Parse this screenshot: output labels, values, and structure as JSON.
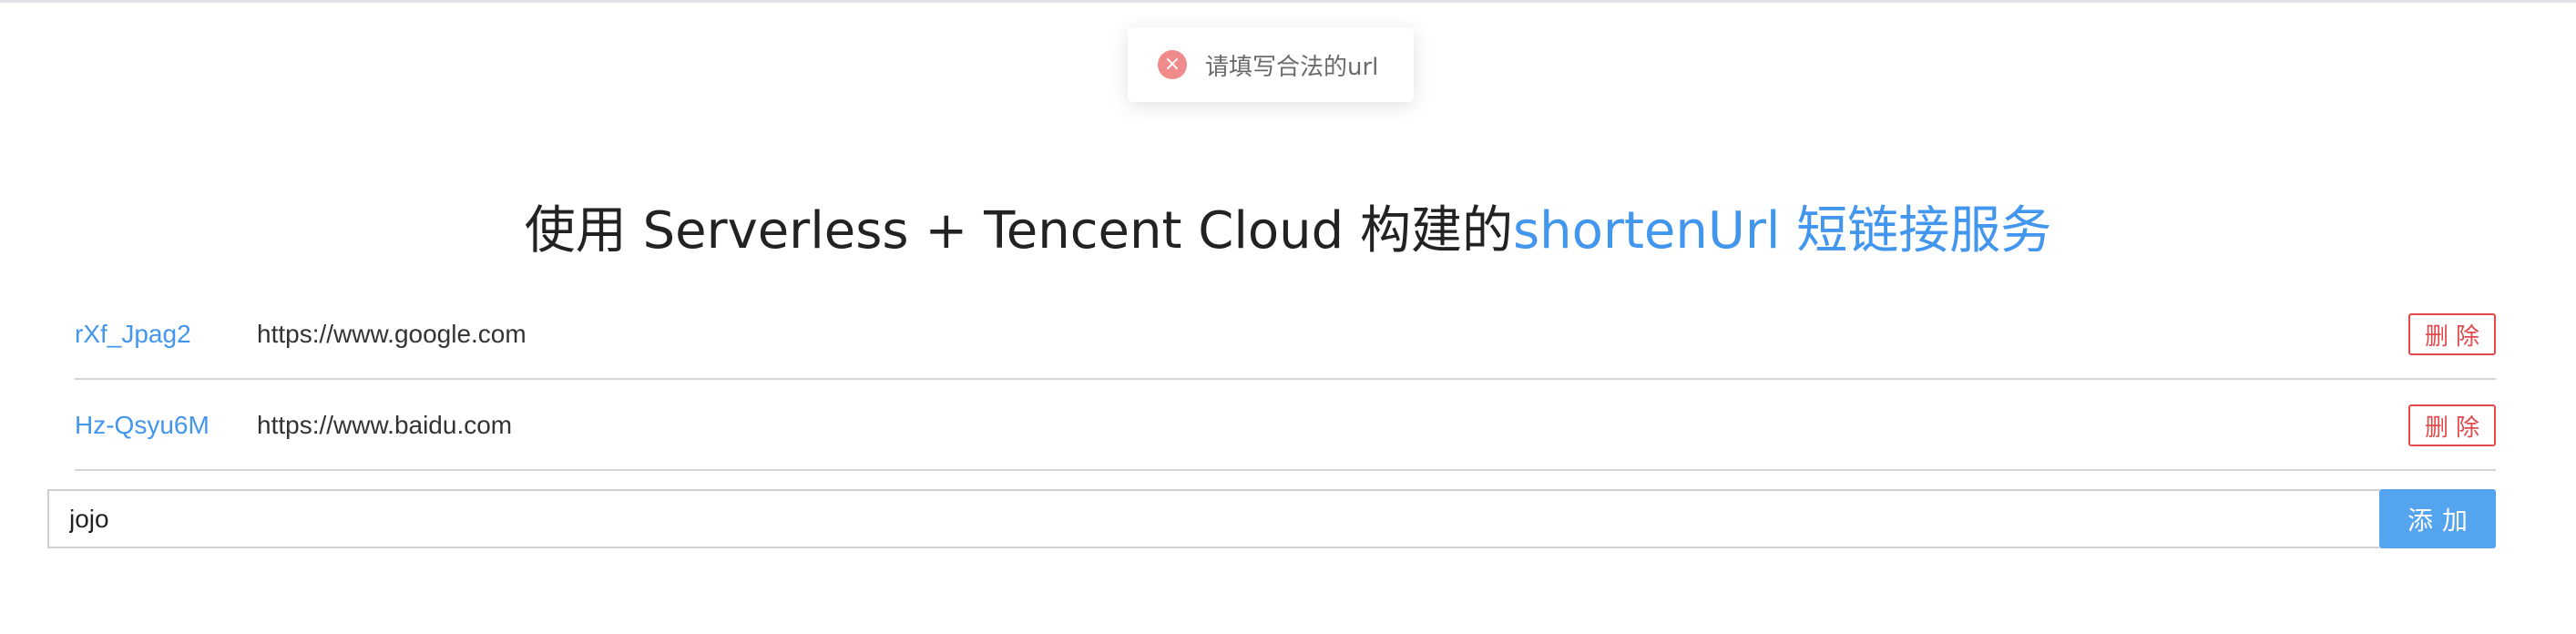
{
  "toast": {
    "icon": "error-icon",
    "icon_glyph": "×",
    "message": "请填写合法的url"
  },
  "header": {
    "title_prefix": "使用 Serverless + Tencent Cloud 构建的",
    "title_accent": "shortenUrl 短链接服务"
  },
  "links": [
    {
      "code": "rXf_Jpag2",
      "url": "https://www.google.com",
      "delete_label": "删除"
    },
    {
      "code": "Hz-Qsyu6M",
      "url": "https://www.baidu.com",
      "delete_label": "删除"
    }
  ],
  "form": {
    "input_value": "jojo",
    "add_label": "添加"
  },
  "colors": {
    "accent": "#4296ee",
    "danger": "#e04a4a",
    "button": "#55a4f0",
    "toast_icon": "#ef8b8b"
  }
}
